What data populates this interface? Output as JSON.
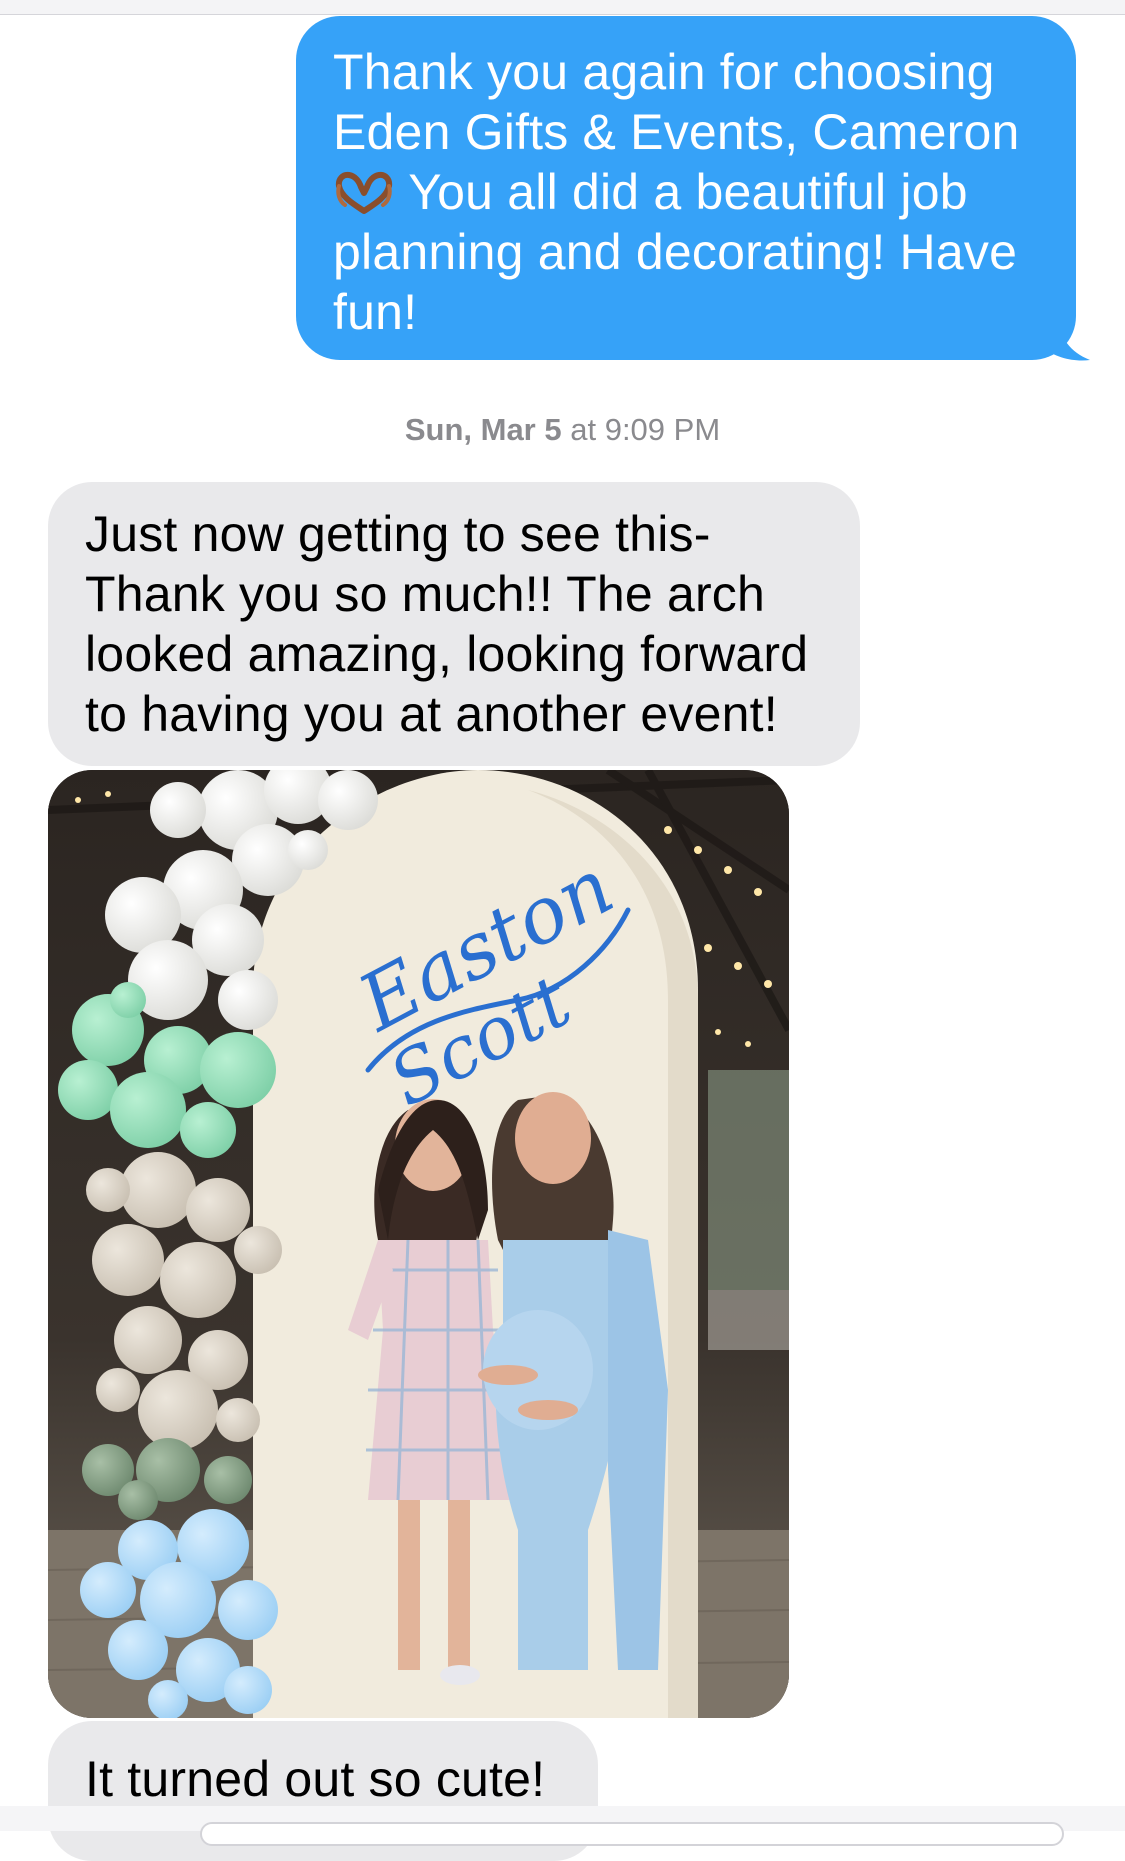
{
  "conversation": {
    "sent_message": {
      "line1": "Thank you again for choosing",
      "line2": "Eden Gifts & Events, Cameron",
      "emoji_icon": "heart-hands-icon",
      "line3": " You all did a beautiful job",
      "line4": "planning and decorating! Have",
      "line5": "fun!"
    },
    "timestamp": {
      "day": "Sun, Mar 5",
      "at": " at ",
      "time": "9:09 PM"
    },
    "received_message_1": {
      "line1": "Just now getting to see this-",
      "line2": "Thank you so much!! The arch",
      "line3": "looked amazing, looking forward",
      "line4": "to having you at another event!"
    },
    "photo": {
      "sign_line1": "Easton",
      "sign_line2": "Scott"
    },
    "received_message_2": {
      "text": "It turned out so cute!"
    }
  },
  "colors": {
    "sent_bubble": "#36a2f8",
    "received_bubble": "#e9e9eb",
    "timestamp_text": "#8a8a8e",
    "sign_script": "#2a6fd0"
  }
}
